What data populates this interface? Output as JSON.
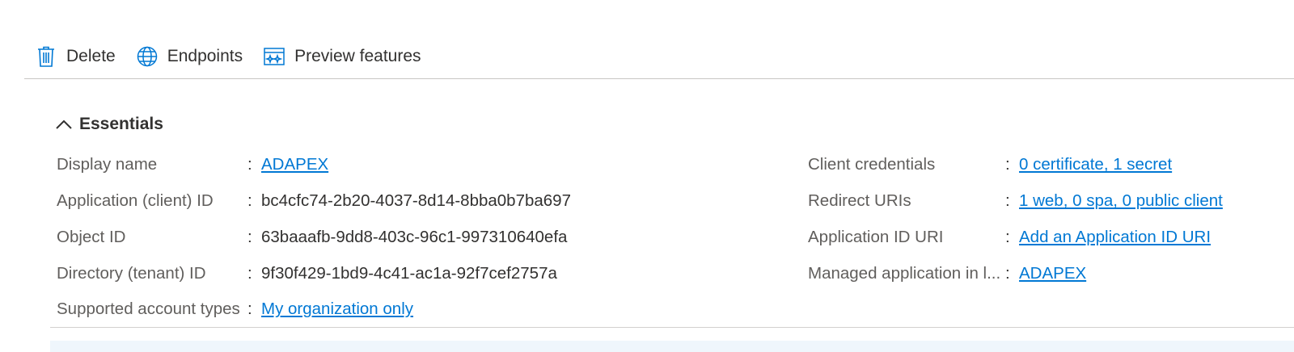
{
  "toolbar": {
    "delete_label": "Delete",
    "endpoints_label": "Endpoints",
    "preview_label": "Preview features"
  },
  "essentials": {
    "title": "Essentials",
    "left": [
      {
        "label": "Display name",
        "value": "ADAPEX",
        "link": true
      },
      {
        "label": "Application (client) ID",
        "value": "bc4cfc74-2b20-4037-8d14-8bba0b7ba697",
        "link": false
      },
      {
        "label": "Object ID",
        "value": "63baaafb-9dd8-403c-96c1-997310640efa",
        "link": false
      },
      {
        "label": "Directory (tenant) ID",
        "value": "9f30f429-1bd9-4c41-ac1a-92f7cef2757a",
        "link": false
      },
      {
        "label": "Supported account types",
        "value": "My organization only",
        "link": true
      }
    ],
    "right": [
      {
        "label": "Client credentials",
        "value": "0 certificate, 1 secret",
        "link": true
      },
      {
        "label": "Redirect URIs",
        "value": "1 web, 0 spa, 0 public client",
        "link": true
      },
      {
        "label": "Application ID URI",
        "value": "Add an Application ID URI",
        "link": true
      },
      {
        "label": "Managed application in l...",
        "value": "ADAPEX",
        "link": true
      }
    ]
  },
  "colors": {
    "accent": "#0078d4",
    "label": "#605e5c",
    "text": "#323130",
    "divider": "#c8c6c4"
  },
  "icons": [
    "trash-icon",
    "globe-icon",
    "preview-icon",
    "chevron-up-icon"
  ]
}
